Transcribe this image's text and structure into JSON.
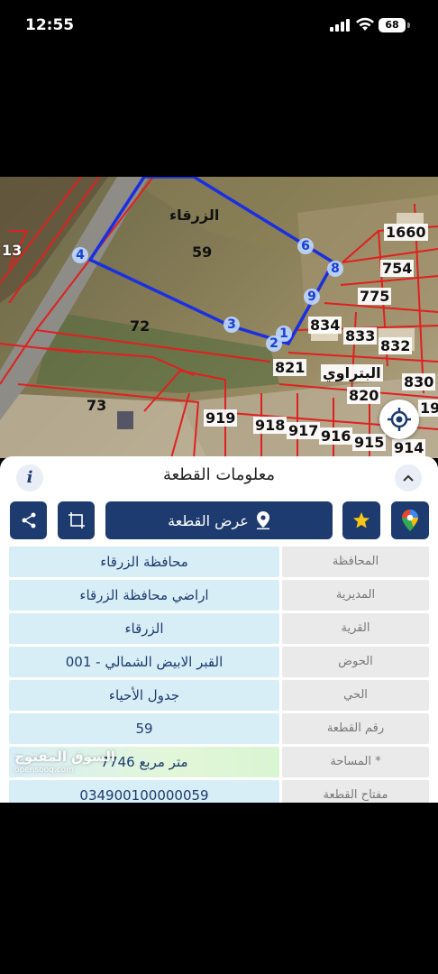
{
  "status_bar": {
    "time": "12:55",
    "battery": "68"
  },
  "map": {
    "labels": {
      "zarqa": "الزرقاء",
      "p59": "59",
      "p72": "72",
      "p73": "73",
      "p13": "13",
      "p1660": "1660",
      "p754": "754",
      "p775": "775",
      "p834": "834",
      "p833": "833",
      "p832": "832",
      "p821": "821",
      "batrawi": "البتراوي",
      "p820": "820",
      "p830": "830",
      "p919": "919",
      "p918": "918",
      "p917": "917",
      "p916": "916",
      "p915": "915",
      "p914": "914",
      "p19": "19"
    },
    "vertices": [
      "1",
      "2",
      "3",
      "4",
      "6",
      "8",
      "9"
    ]
  },
  "panel": {
    "title": "معلومات القطعة",
    "info_label": "i",
    "show_parcel_label": "عرض القطعة",
    "rows": [
      {
        "key": "المحافظة",
        "value": "محافظة الزرقاء"
      },
      {
        "key": "المديرية",
        "value": "اراضي محافظة الزرقاء"
      },
      {
        "key": "القرية",
        "value": "الزرقاء"
      },
      {
        "key": "الحوض",
        "value": "القبر الابيض الشمالي - 001"
      },
      {
        "key": "الحي",
        "value": "جدول الأحياء"
      },
      {
        "key": "رقم القطعة",
        "value": "59"
      },
      {
        "key": "المساحة *",
        "value": "7746   متر مربع"
      },
      {
        "key": "مفتاح القطعة",
        "value": "034900100000059"
      }
    ],
    "watermark": {
      "brand": "السوق المفتوح",
      "site": "opensooq.com"
    }
  },
  "colors": {
    "navy": "#1d3b6e",
    "parcel_line": "#e02020",
    "boundary": "#1a2fe0",
    "star": "#f5c518"
  }
}
